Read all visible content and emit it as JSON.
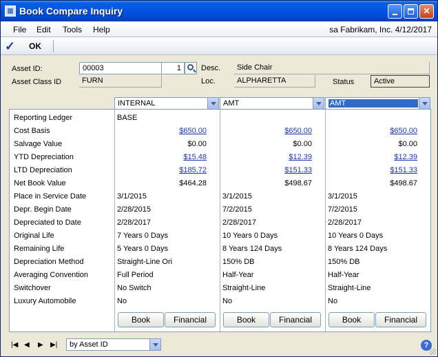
{
  "window": {
    "title": "Book Compare Inquiry"
  },
  "menu": {
    "file": "File",
    "edit": "Edit",
    "tools": "Tools",
    "help": "Help",
    "status": "sa  Fabrikam, Inc.  4/12/2017"
  },
  "toolbar": {
    "ok_label": "OK"
  },
  "header": {
    "asset_id_label": "Asset ID:",
    "asset_id_value": "00003",
    "asset_suffix": "1",
    "desc_label": "Desc.",
    "desc_value": "Side Chair",
    "asset_class_label": "Asset Class ID",
    "asset_class_value": "FURN",
    "loc_label": "Loc.",
    "loc_value": "ALPHARETTA",
    "status_label": "Status",
    "status_value": "Active"
  },
  "row_labels": [
    "Reporting Ledger",
    "Cost Basis",
    "Salvage Value",
    "YTD Depreciation",
    "LTD Depreciation",
    "Net Book Value",
    "Place in Service Date",
    "Depr. Begin Date",
    "Depreciated to Date",
    "Original Life",
    "Remaining Life",
    "Depreciation Method",
    "Averaging Convention",
    "Switchover",
    "Luxury Automobile"
  ],
  "columns": [
    {
      "book": "INTERNAL",
      "reporting_ledger": "BASE",
      "cost_basis": "$650.00",
      "salvage_value": "$0.00",
      "ytd_depreciation": "$15.48",
      "ltd_depreciation": "$185.72",
      "net_book_value": "$464.28",
      "place_in_service": "3/1/2015",
      "depr_begin": "2/28/2015",
      "depreciated_to": "2/28/2017",
      "original_life": "7 Years 0 Days",
      "remaining_life": "5 Years 0 Days",
      "method": "Straight-Line Ori",
      "convention": "Full Period",
      "switchover": "No Switch",
      "luxury": "No",
      "book_btn": "Book",
      "financial_btn": "Financial"
    },
    {
      "book": "AMT",
      "reporting_ledger": "",
      "cost_basis": "$650.00",
      "salvage_value": "$0.00",
      "ytd_depreciation": "$12.39",
      "ltd_depreciation": "$151.33",
      "net_book_value": "$498.67",
      "place_in_service": "3/1/2015",
      "depr_begin": "7/2/2015",
      "depreciated_to": "2/28/2017",
      "original_life": "10 Years 0 Days",
      "remaining_life": "8 Years 124 Days",
      "method": "150% DB",
      "convention": "Half-Year",
      "switchover": "Straight-Line",
      "luxury": "No",
      "book_btn": "Book",
      "financial_btn": "Financial"
    },
    {
      "book": "AMT",
      "reporting_ledger": "",
      "cost_basis": "$650.00",
      "salvage_value": "$0.00",
      "ytd_depreciation": "$12.39",
      "ltd_depreciation": "$151.33",
      "net_book_value": "$498.67",
      "place_in_service": "3/1/2015",
      "depr_begin": "7/2/2015",
      "depreciated_to": "2/28/2017",
      "original_life": "10 Years 0 Days",
      "remaining_life": "8 Years 124 Days",
      "method": "150% DB",
      "convention": "Half-Year",
      "switchover": "Straight-Line",
      "luxury": "No",
      "book_btn": "Book",
      "financial_btn": "Financial"
    }
  ],
  "footer": {
    "sort_value": "by Asset ID"
  }
}
